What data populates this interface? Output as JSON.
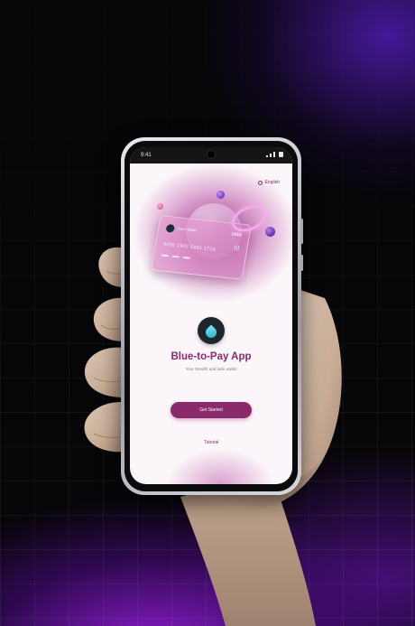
{
  "colors": {
    "brand": "#8b2a6b",
    "accent_teal": "#2bb7cf",
    "background_purple": "#7a1ec8",
    "screen_background": "#fbf6f9"
  },
  "status_bar": {
    "time": "9:41"
  },
  "language": {
    "icon": "globe-icon",
    "label": "English"
  },
  "hero": {
    "card": {
      "holder": "Card Holder",
      "brand": "VISA",
      "number": "4450 1902 5442 1725"
    }
  },
  "app": {
    "logo_icon": "water-drop-icon",
    "title": "Blue-to-Pay App",
    "subtitle": "Your Wealth and safe wallet"
  },
  "actions": {
    "get_started": "Get Started",
    "tutorial": "Tutorial"
  }
}
